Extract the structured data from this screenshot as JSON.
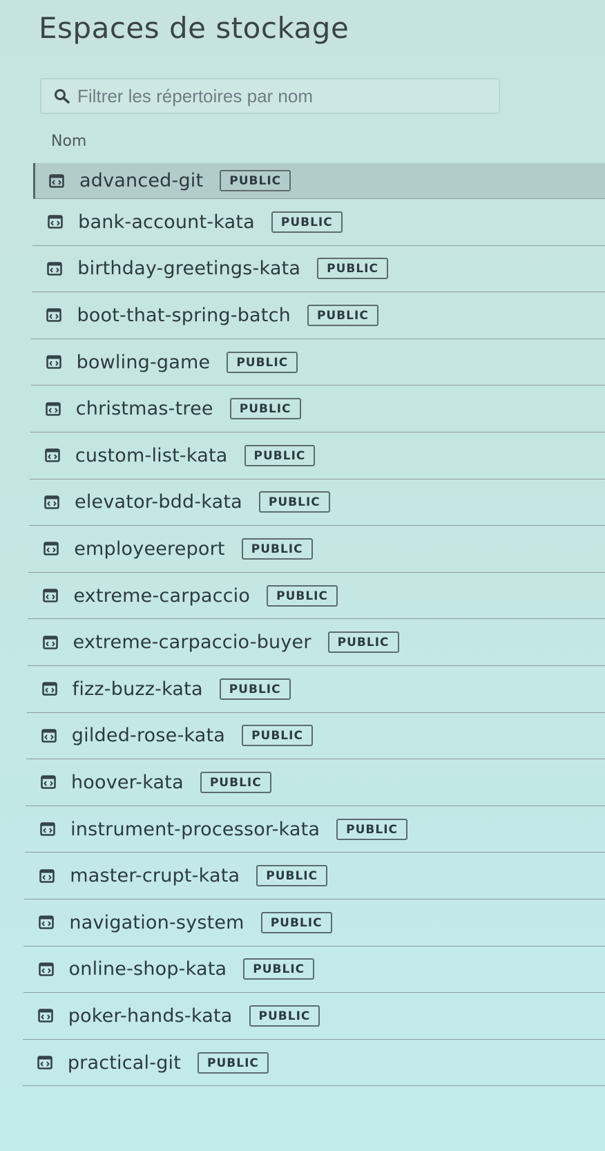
{
  "page": {
    "title": "Espaces de stockage"
  },
  "search": {
    "placeholder": "Filtrer les répertoires par nom",
    "value": "",
    "icon": "search-icon"
  },
  "table": {
    "column_header": "Nom",
    "selected_index": 0,
    "rows": [
      {
        "name": "advanced-git",
        "badge": "PUBLIC",
        "icon": "repository-icon"
      },
      {
        "name": "bank-account-kata",
        "badge": "PUBLIC",
        "icon": "repository-icon"
      },
      {
        "name": "birthday-greetings-kata",
        "badge": "PUBLIC",
        "icon": "repository-icon"
      },
      {
        "name": "boot-that-spring-batch",
        "badge": "PUBLIC",
        "icon": "repository-icon"
      },
      {
        "name": "bowling-game",
        "badge": "PUBLIC",
        "icon": "repository-icon"
      },
      {
        "name": "christmas-tree",
        "badge": "PUBLIC",
        "icon": "repository-icon"
      },
      {
        "name": "custom-list-kata",
        "badge": "PUBLIC",
        "icon": "repository-icon"
      },
      {
        "name": "elevator-bdd-kata",
        "badge": "PUBLIC",
        "icon": "repository-icon"
      },
      {
        "name": "employeereport",
        "badge": "PUBLIC",
        "icon": "repository-icon"
      },
      {
        "name": "extreme-carpaccio",
        "badge": "PUBLIC",
        "icon": "repository-icon"
      },
      {
        "name": "extreme-carpaccio-buyer",
        "badge": "PUBLIC",
        "icon": "repository-icon"
      },
      {
        "name": "fizz-buzz-kata",
        "badge": "PUBLIC",
        "icon": "repository-icon"
      },
      {
        "name": "gilded-rose-kata",
        "badge": "PUBLIC",
        "icon": "repository-icon"
      },
      {
        "name": "hoover-kata",
        "badge": "PUBLIC",
        "icon": "repository-icon"
      },
      {
        "name": "instrument-processor-kata",
        "badge": "PUBLIC",
        "icon": "repository-icon"
      },
      {
        "name": "master-crupt-kata",
        "badge": "PUBLIC",
        "icon": "repository-icon"
      },
      {
        "name": "navigation-system",
        "badge": "PUBLIC",
        "icon": "repository-icon"
      },
      {
        "name": "online-shop-kata",
        "badge": "PUBLIC",
        "icon": "repository-icon"
      },
      {
        "name": "poker-hands-kata",
        "badge": "PUBLIC",
        "icon": "repository-icon"
      },
      {
        "name": "practical-git",
        "badge": "PUBLIC",
        "icon": "repository-icon"
      }
    ]
  }
}
